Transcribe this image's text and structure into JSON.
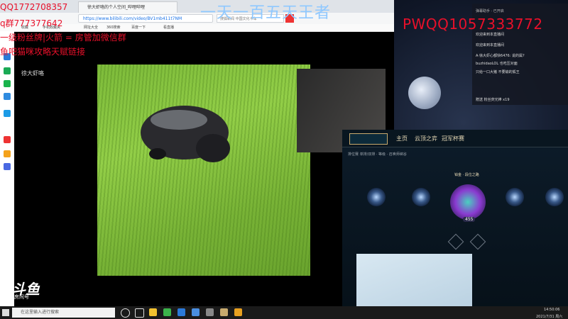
{
  "overlay": {
    "qq": "QQ1772708357",
    "group": "q群777377642",
    "fan_badge": "一级粉丝牌|火箭 = 房管加微信群",
    "tips": "鱼吧猫咪攻略天赋链接",
    "title": "一天一百五天王者",
    "pwqq": "PWQQ1057333772"
  },
  "browser": {
    "tab_label": "徐大虾咯的个人空间_哔哩哔哩",
    "url": "https://www.bilibili.com/video/BV1mb411t7NM",
    "search_placeholder": "搜狐新闻 中国文化卡车",
    "bookmarks": [
      "收藏",
      "手机收藏夹",
      "网址大全",
      "360搜索",
      "游戏中心",
      "百度一下",
      "看直播"
    ],
    "streamer_name": "徐大虾咯"
  },
  "lol": {
    "nav": [
      "主页",
      "云顶之弈",
      "冠军杯赛"
    ],
    "breadcrumb": "排位赛 单排/双排 · 等级 · 召唤师峡谷",
    "rank_label": "铂金 · 段位之路",
    "rank_value": "455"
  },
  "taskbar": {
    "search_placeholder": "在这里输入你要搜索的内容",
    "search_text": "在这里输入进行搜索",
    "time": "14:50:06",
    "date": "2021/7/31 周六"
  },
  "stream": {
    "brand": "斗鱼",
    "room": "房间号",
    "room_id": "781142"
  }
}
